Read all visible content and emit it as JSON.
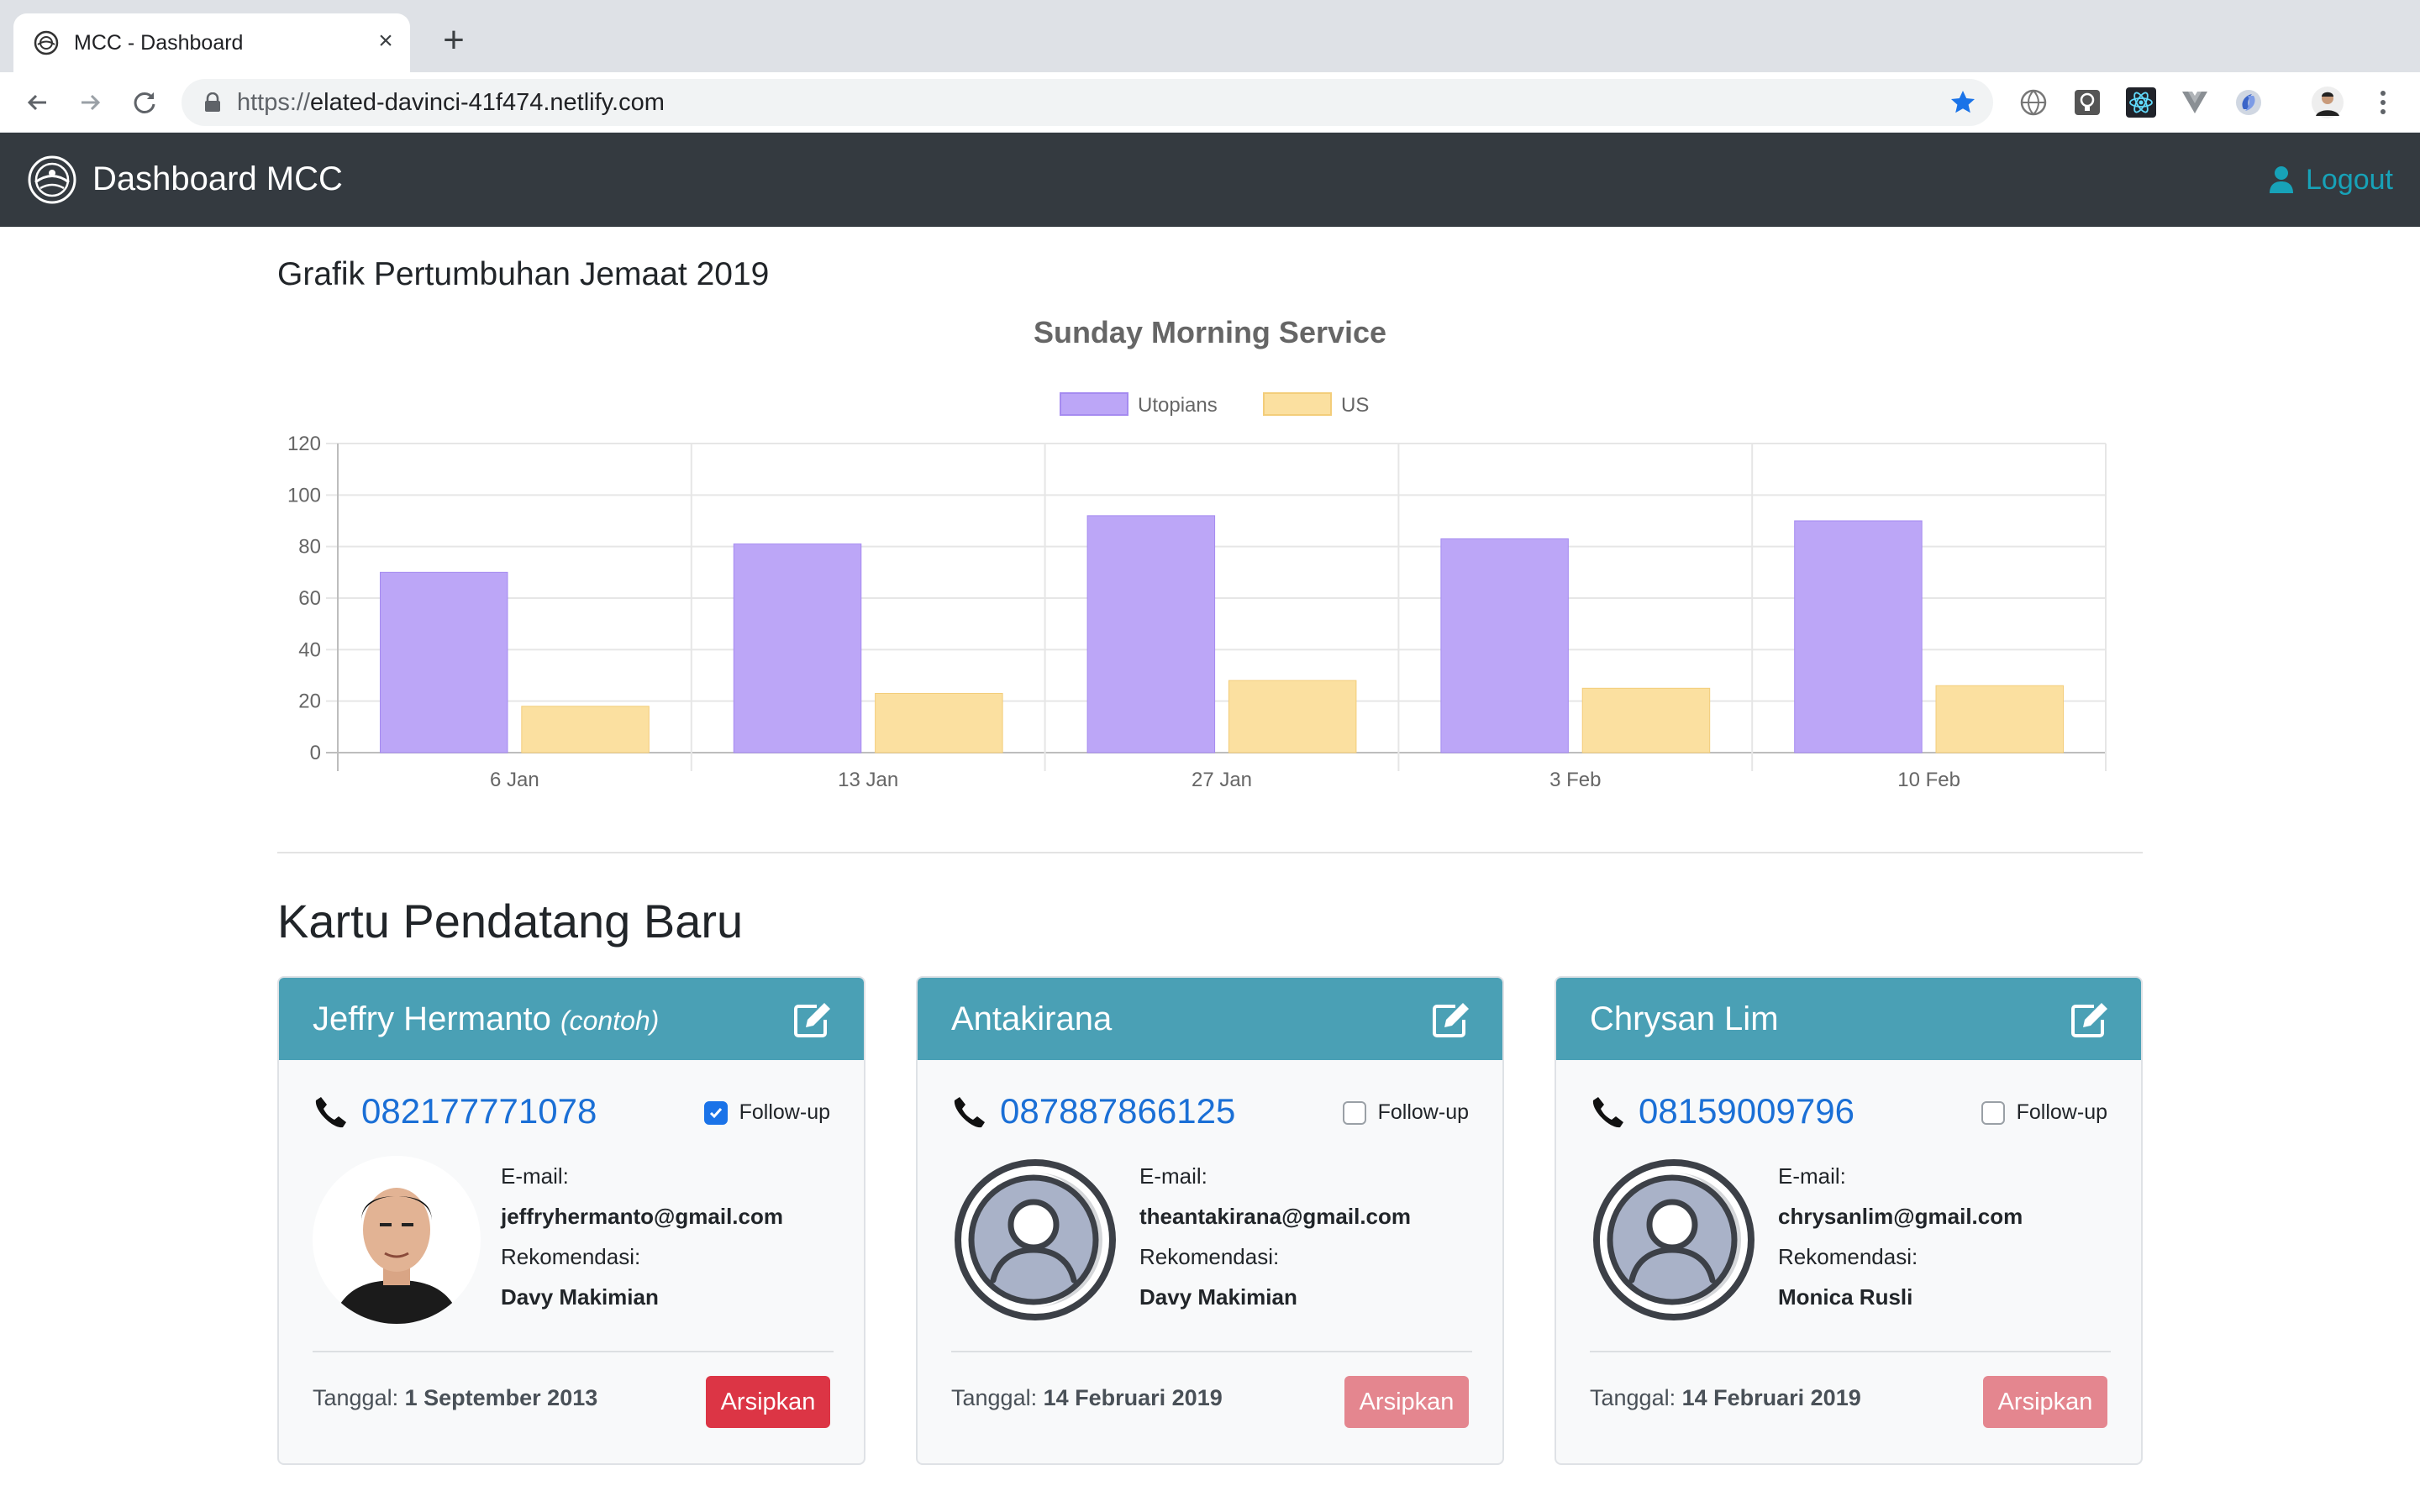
{
  "browser": {
    "tab_title": "MCC - Dashboard",
    "url_scheme": "https://",
    "url_host": "elated-davinci-41f474.netlify.com",
    "icons": [
      "back-icon",
      "forward-icon",
      "reload-icon",
      "lock-icon",
      "star-icon",
      "globe-extension-icon",
      "bulb-extension-icon",
      "react-extension-icon",
      "vue-extension-icon",
      "sync-extension-icon",
      "profile-avatar-icon",
      "menu-icon"
    ]
  },
  "navbar": {
    "brand": "Dashboard MCC",
    "logout_label": "Logout",
    "accent_color": "#17a2b8",
    "bg_color": "#343a40"
  },
  "chart_section": {
    "heading": "Grafik Pertumbuhan Jemaat 2019"
  },
  "chart_data": {
    "type": "bar",
    "title": "Sunday Morning Service",
    "categories": [
      "6 Jan",
      "13 Jan",
      "27 Jan",
      "3 Feb",
      "10 Feb"
    ],
    "series": [
      {
        "name": "Utopians",
        "values": [
          70,
          81,
          92,
          83,
          90
        ],
        "color": "#bca6f7"
      },
      {
        "name": "US",
        "values": [
          18,
          23,
          28,
          25,
          26
        ],
        "color": "#fbe0a0"
      }
    ],
    "ylim": [
      0,
      120
    ],
    "yticks": [
      "0",
      "20",
      "40",
      "60",
      "80",
      "100",
      "120"
    ],
    "xlabel": "",
    "ylabel": "",
    "grid": true,
    "legend": "top"
  },
  "cards_section": {
    "heading": "Kartu Pendatang Baru",
    "labels": {
      "followup": "Follow-up",
      "email": "E-mail:",
      "recommend": "Rekomendasi:",
      "date": "Tanggal:",
      "archive": "Arsipkan"
    },
    "cards": [
      {
        "name": "Jeffry Hermanto",
        "tag": "(contoh)",
        "phone": "082177771078",
        "followup_checked": true,
        "email": "jeffryhermanto@gmail.com",
        "recommender": "Davy Makimian",
        "date": "1 September 2013",
        "avatar": "photo",
        "archive_state": "active"
      },
      {
        "name": "Antakirana",
        "tag": "",
        "phone": "087887866125",
        "followup_checked": false,
        "email": "theantakirana@gmail.com",
        "recommender": "Davy Makimian",
        "date": "14 Februari 2019",
        "avatar": "placeholder-user-icon",
        "archive_state": "faded"
      },
      {
        "name": "Chrysan Lim",
        "tag": "",
        "phone": "08159009796",
        "followup_checked": false,
        "email": "chrysanlim@gmail.com",
        "recommender": "Monica Rusli",
        "date": "14 Februari 2019",
        "avatar": "placeholder-user-icon",
        "archive_state": "faded"
      }
    ]
  }
}
